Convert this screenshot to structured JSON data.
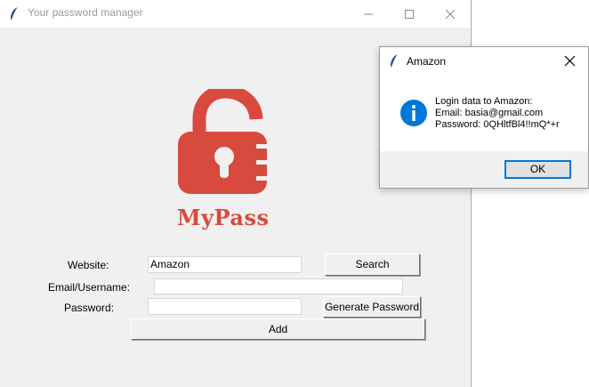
{
  "main_window": {
    "title": "Your password manager",
    "logo_text": "MyPass",
    "form": {
      "website_label": "Website:",
      "website_value": "Amazon",
      "email_label": "Email/Username:",
      "email_value": "",
      "password_label": "Password:",
      "password_value": "",
      "search_button": "Search",
      "generate_button": "Generate Password",
      "add_button": "Add"
    }
  },
  "dialog": {
    "title": "Amazon",
    "message_lines": [
      "Login data to Amazon:",
      "Email: basia@gmail.com",
      "Password: 0QHltfBl4!!mQ*+r"
    ],
    "ok_button": "OK",
    "icon": "info-icon"
  },
  "colors": {
    "logo_red": "#d84a3e",
    "info_blue": "#0078d7",
    "window_bg": "#f0f0f0"
  }
}
